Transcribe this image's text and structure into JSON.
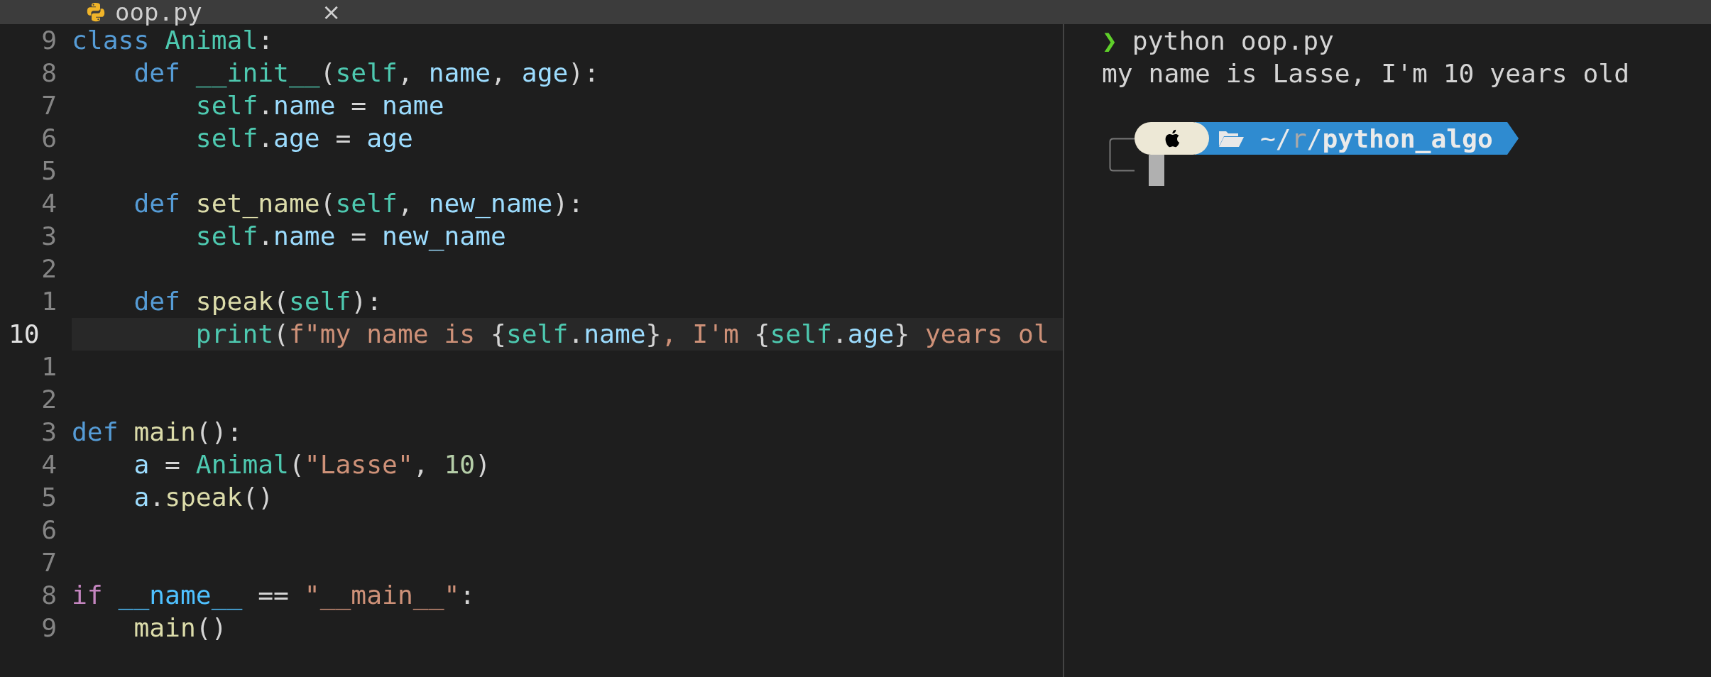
{
  "tab": {
    "title": "oop.py",
    "close": "×"
  },
  "editor": {
    "lines": [
      {
        "number": "9",
        "selected": false,
        "tokens": [
          {
            "kind": "keyword",
            "text": "class "
          },
          {
            "kind": "type",
            "text": "Animal"
          },
          {
            "kind": "plain",
            "text": ":"
          }
        ]
      },
      {
        "number": "8",
        "selected": false,
        "tokens": [
          {
            "kind": "keyword",
            "text": "    def "
          },
          {
            "kind": "type",
            "text": "__init__"
          },
          {
            "kind": "plain",
            "text": "("
          },
          {
            "kind": "type",
            "text": "self"
          },
          {
            "kind": "plain",
            "text": ", "
          },
          {
            "kind": "param",
            "text": "name"
          },
          {
            "kind": "plain",
            "text": ", "
          },
          {
            "kind": "param",
            "text": "age"
          },
          {
            "kind": "plain",
            "text": "):"
          }
        ]
      },
      {
        "number": "7",
        "selected": false,
        "tokens": [
          {
            "kind": "type",
            "text": "        self"
          },
          {
            "kind": "plain",
            "text": "."
          },
          {
            "kind": "param",
            "text": "name"
          },
          {
            "kind": "plain",
            "text": " = "
          },
          {
            "kind": "param",
            "text": "name"
          }
        ]
      },
      {
        "number": "6",
        "selected": false,
        "tokens": [
          {
            "kind": "type",
            "text": "        self"
          },
          {
            "kind": "plain",
            "text": "."
          },
          {
            "kind": "param",
            "text": "age"
          },
          {
            "kind": "plain",
            "text": " = "
          },
          {
            "kind": "param",
            "text": "age"
          }
        ]
      },
      {
        "number": "5",
        "selected": false
      },
      {
        "number": "4",
        "selected": false,
        "tokens": [
          {
            "kind": "keyword",
            "text": "    def "
          },
          {
            "kind": "func",
            "text": "set_name"
          },
          {
            "kind": "plain",
            "text": "("
          },
          {
            "kind": "type",
            "text": "self"
          },
          {
            "kind": "plain",
            "text": ", "
          },
          {
            "kind": "param",
            "text": "new_name"
          },
          {
            "kind": "plain",
            "text": "):"
          }
        ]
      },
      {
        "number": "3",
        "selected": false,
        "tokens": [
          {
            "kind": "type",
            "text": "        self"
          },
          {
            "kind": "plain",
            "text": "."
          },
          {
            "kind": "param",
            "text": "name"
          },
          {
            "kind": "plain",
            "text": " = "
          },
          {
            "kind": "param",
            "text": "new_name"
          }
        ]
      },
      {
        "number": "2",
        "selected": false
      },
      {
        "number": "1",
        "selected": false,
        "tokens": [
          {
            "kind": "keyword",
            "text": "    def "
          },
          {
            "kind": "func",
            "text": "speak"
          },
          {
            "kind": "plain",
            "text": "("
          },
          {
            "kind": "type",
            "text": "self"
          },
          {
            "kind": "plain",
            "text": "):"
          }
        ]
      },
      {
        "number": "10",
        "selected": true,
        "tokens": [
          {
            "kind": "type",
            "text": "        print"
          },
          {
            "kind": "plain",
            "text": "("
          },
          {
            "kind": "string",
            "text": "f\"my name is "
          },
          {
            "kind": "plain",
            "text": "{"
          },
          {
            "kind": "type",
            "text": "self"
          },
          {
            "kind": "plain",
            "text": "."
          },
          {
            "kind": "param",
            "text": "name"
          },
          {
            "kind": "plain",
            "text": "}"
          },
          {
            "kind": "string",
            "text": ", I'm "
          },
          {
            "kind": "plain",
            "text": "{"
          },
          {
            "kind": "type",
            "text": "self"
          },
          {
            "kind": "plain",
            "text": "."
          },
          {
            "kind": "param",
            "text": "age"
          },
          {
            "kind": "plain",
            "text": "}"
          },
          {
            "kind": "string",
            "text": " years ol"
          }
        ]
      },
      {
        "number": "1",
        "selected": false
      },
      {
        "number": "2",
        "selected": false
      },
      {
        "number": "3",
        "selected": false,
        "tokens": [
          {
            "kind": "keyword",
            "text": "def "
          },
          {
            "kind": "func",
            "text": "main"
          },
          {
            "kind": "plain",
            "text": "():"
          }
        ]
      },
      {
        "number": "4",
        "selected": false,
        "tokens": [
          {
            "kind": "param",
            "text": "    a"
          },
          {
            "kind": "plain",
            "text": " = "
          },
          {
            "kind": "type",
            "text": "Animal"
          },
          {
            "kind": "plain",
            "text": "("
          },
          {
            "kind": "string",
            "text": "\"Lasse\""
          },
          {
            "kind": "plain",
            "text": ", "
          },
          {
            "kind": "number",
            "text": "10"
          },
          {
            "kind": "plain",
            "text": ")"
          }
        ]
      },
      {
        "number": "5",
        "selected": false,
        "tokens": [
          {
            "kind": "param",
            "text": "    a"
          },
          {
            "kind": "plain",
            "text": "."
          },
          {
            "kind": "func",
            "text": "speak"
          },
          {
            "kind": "plain",
            "text": "()"
          }
        ]
      },
      {
        "number": "6",
        "selected": false
      },
      {
        "number": "7",
        "selected": false
      },
      {
        "number": "8",
        "selected": false,
        "tokens": [
          {
            "kind": "control",
            "text": "if "
          },
          {
            "kind": "builtin",
            "text": "__name__"
          },
          {
            "kind": "plain",
            "text": " == "
          },
          {
            "kind": "string",
            "text": "\"__main__\""
          },
          {
            "kind": "plain",
            "text": ":"
          }
        ]
      },
      {
        "number": "9",
        "selected": false,
        "tokens": [
          {
            "kind": "func",
            "text": "    main"
          },
          {
            "kind": "plain",
            "text": "()"
          }
        ]
      }
    ]
  },
  "terminal": {
    "prompt": "❯",
    "command": "python oop.py",
    "output": "my name is Lasse, I'm 10 years old",
    "path": [
      {
        "kind": "plain",
        "text": "~/"
      },
      {
        "kind": "dim",
        "text": "r"
      },
      {
        "kind": "plain",
        "text": "/"
      },
      {
        "kind": "bold",
        "text": "python_algo"
      }
    ]
  }
}
